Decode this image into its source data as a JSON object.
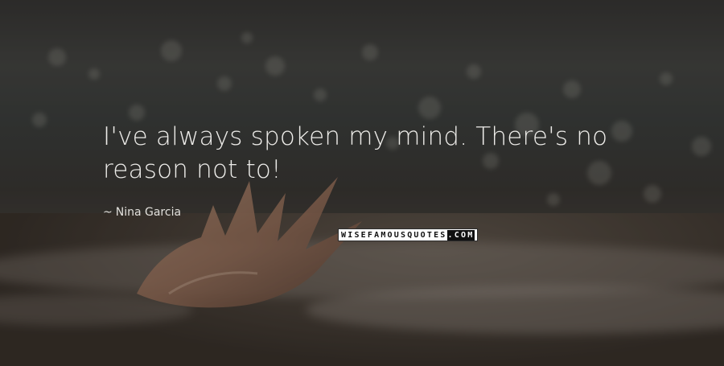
{
  "quote": {
    "text": "I've always spoken my mind. There's no reason not to!",
    "author_dash": "~",
    "author": "Nina Garcia"
  },
  "branding": {
    "logo_main": "WISEFAMOUSQUOTES",
    "logo_suffix": ".COM"
  },
  "colors": {
    "text": "#ecebe8",
    "overlay": "#141210"
  }
}
